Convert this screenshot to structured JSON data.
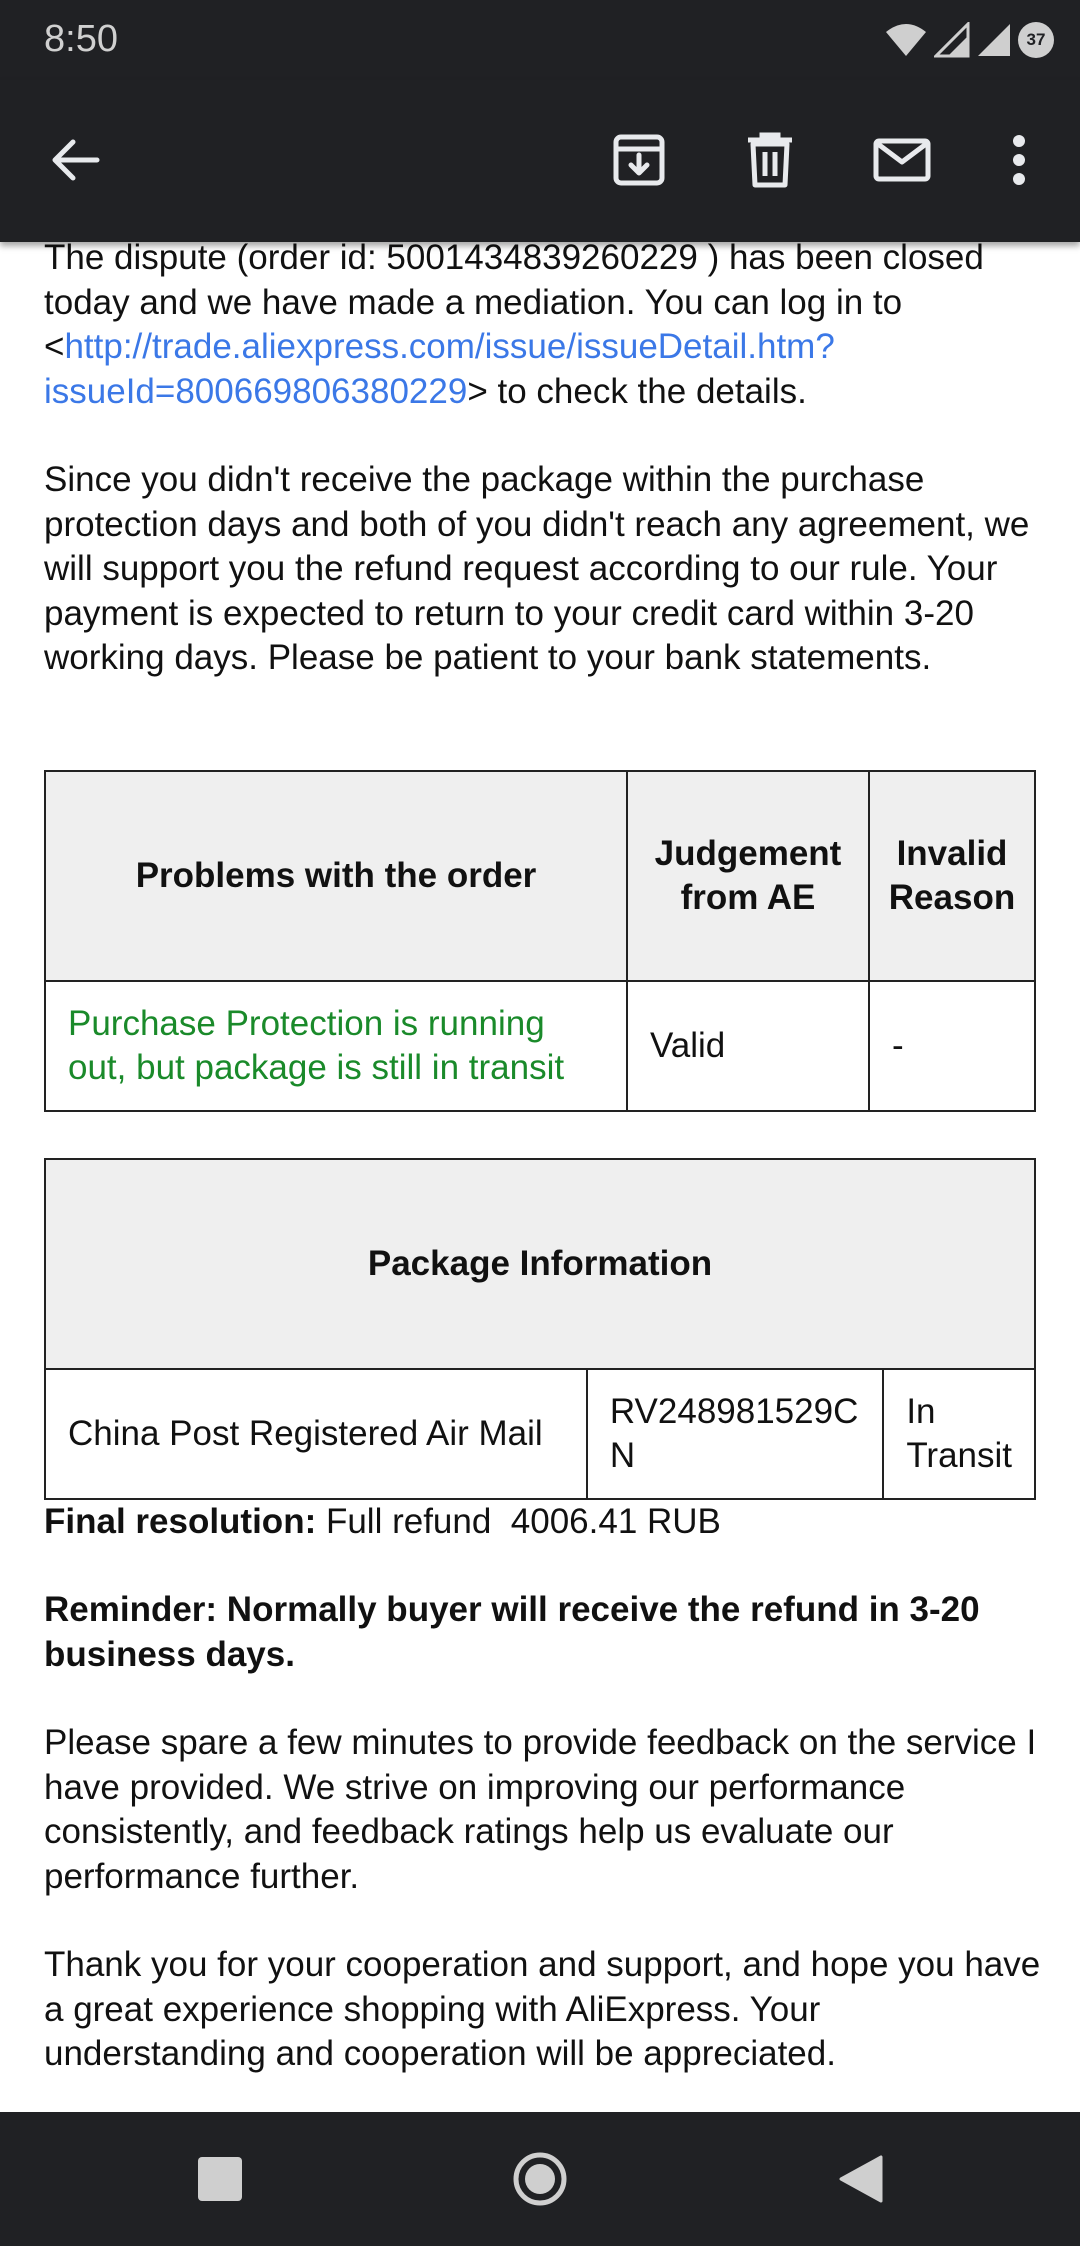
{
  "status_bar": {
    "time": "8:50",
    "battery_level": "37"
  },
  "toolbar": {
    "back_icon": "arrow-left-icon",
    "archive_icon": "archive-icon",
    "delete_icon": "trash-icon",
    "mark_unread_icon": "envelope-icon",
    "more_icon": "more-vert-icon"
  },
  "email": {
    "p1_before": "The dispute (order id: 5001434839260229 ) has been closed today and we have made a mediation. You can log in to <",
    "p1_link": "http://trade.aliexpress.com/issue/issueDetail.htm?issueId=800669806380229",
    "p1_after": "> to check the details.",
    "p2": "Since you didn't receive the package within the purchase protection days and both of you didn't reach any agreement, we will support you the refund request according to our rule. Your payment is expected to return to your credit card within 3-20 working days. Please be patient to your bank statements.",
    "table1": {
      "headers": [
        "Problems with the order",
        "Judgement from AE",
        "Invalid Reason"
      ],
      "row": [
        "Purchase Protection is running out, but package is still in transit",
        "Valid",
        "-"
      ]
    },
    "table2": {
      "header": "Package Information",
      "row": [
        "China Post Registered Air Mail",
        "RV248981529CN",
        "In Transit"
      ]
    },
    "final_label": "Final resolution:",
    "final_value": " Full refund  4006.41 RUB",
    "reminder": "Reminder: Normally buyer will receive the refund in 3-20 business days.",
    "p3": "Please spare a few minutes to provide feedback on the service I have provided. We strive on improving our performance consistently, and feedback ratings help us evaluate our performance further.",
    "p4": "Thank you for your cooperation and support, and hope you have a great experience shopping with AliExpress. Your understanding and cooperation will be appreciated."
  },
  "nav_bar": {
    "recents_icon": "square-icon",
    "home_icon": "circle-icon",
    "back_icon": "triangle-back-icon"
  },
  "colors": {
    "bar_bg": "#202124",
    "link": "#3b78e7",
    "valid_green": "#1a8a2a",
    "header_bg": "#efefef"
  }
}
